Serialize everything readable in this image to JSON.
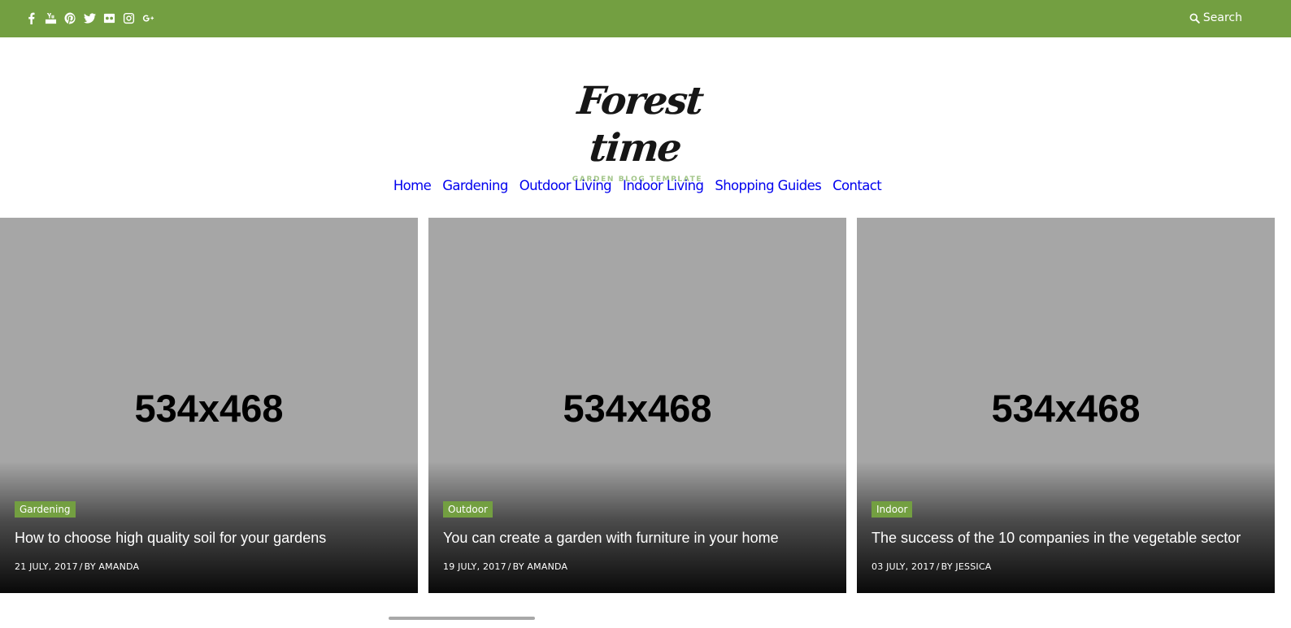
{
  "topbar": {
    "color": "#739f41",
    "social_icons": [
      "facebook-icon",
      "youtube-icon",
      "pinterest-icon",
      "twitter-icon",
      "flickr-icon",
      "instagram-icon",
      "google-plus-icon"
    ],
    "search_label": "Search"
  },
  "logo": {
    "name": "Forest time",
    "tagline": "GARDEN BLOG TEMPLATE"
  },
  "nav": {
    "items": [
      "Home",
      "Gardening",
      "Outdoor Living",
      "Indoor Living",
      "Shopping Guides",
      "Contact"
    ]
  },
  "posts": [
    {
      "placeholder": "534x468",
      "category": "Gardening",
      "title": "How to choose high quality soil for your gardens",
      "date": "21 JULY, 2017",
      "author": "BY AMANDA"
    },
    {
      "placeholder": "534x468",
      "category": "Outdoor",
      "title": "You can create a garden with furniture in your home",
      "date": "19 JULY, 2017",
      "author": "BY AMANDA"
    },
    {
      "placeholder": "534x468",
      "category": "Indoor",
      "title": "The success of the 10 companies in the vegetable sector",
      "date": "03 JULY, 2017",
      "author": "BY JESSICA"
    }
  ],
  "meta_separator": "/",
  "accent_color": "#739f41"
}
